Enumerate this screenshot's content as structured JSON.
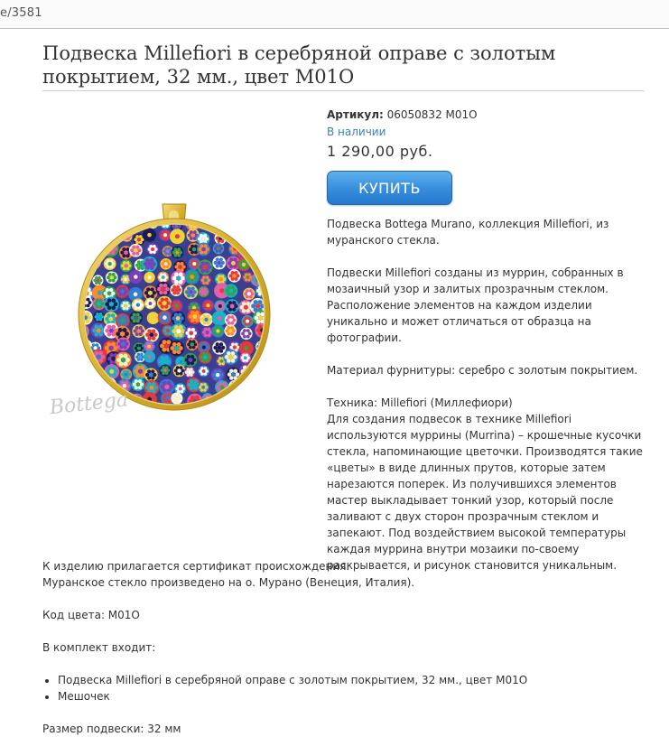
{
  "browser": {
    "url_fragment": "e/3581"
  },
  "product": {
    "title": "Подвеска Millefiori в серебряной оправе с золотым покрытием, 32 мм., цвет M01O",
    "sku_label": "Артикул:",
    "sku_value": "06050832 M01O",
    "stock_status": "В наличии",
    "price": "1 290,00 руб.",
    "buy_button": "КУПИТЬ",
    "image_watermark": "Bottega Murano"
  },
  "description": {
    "p1": "Подвеска Bottega Murano, коллекция Millefiori, из муранского стекла.",
    "p2": "Подвески Millefiori созданы из муррин, собранных в мозаичный узор и залитых прозрачным стеклом. Расположение элементов на каждом изделии уникально и может отличаться от образца на фотографии.",
    "p3": "Материал фурнитуры: серебро с золотым покрытием.",
    "technique_title": "Техника: Millefiori (Миллефиори)",
    "technique_text": "Для создания подвесок в технике Millefiori используются муррины (Murrina) – крошечные кусочки стекла, напоминающие цветочки. Производятся такие «цветы» в виде длинных прутов, которые затем нарезаются поперек. Из получившихся элементов мастер выкладывает тонкий узор, который после заливают с двух сторон прозрачным стеклом и запекают. Под воздействием высокой температуры каждая муррина внутри мозаики по-своему раскрывается, и рисунок становится уникальным."
  },
  "details": {
    "certificate": "К изделию прилагается сертификат происхождения.",
    "origin": "Муранское стекло произведено на о. Мурано (Венеция, Италия).",
    "color_code": "Код цвета: M01O",
    "kit_title": "В комплект входит:",
    "kit_items": [
      "Подвеска Millefiori в серебряной оправе с золотым покрытием, 32 мм., цвет M01O",
      "Мешочек"
    ],
    "size": "Размер подвески: 32 мм"
  },
  "colors": {
    "link_blue": "#3b7fb8",
    "button_blue": "#2f86d6",
    "gold_frame": "#d8b534"
  }
}
